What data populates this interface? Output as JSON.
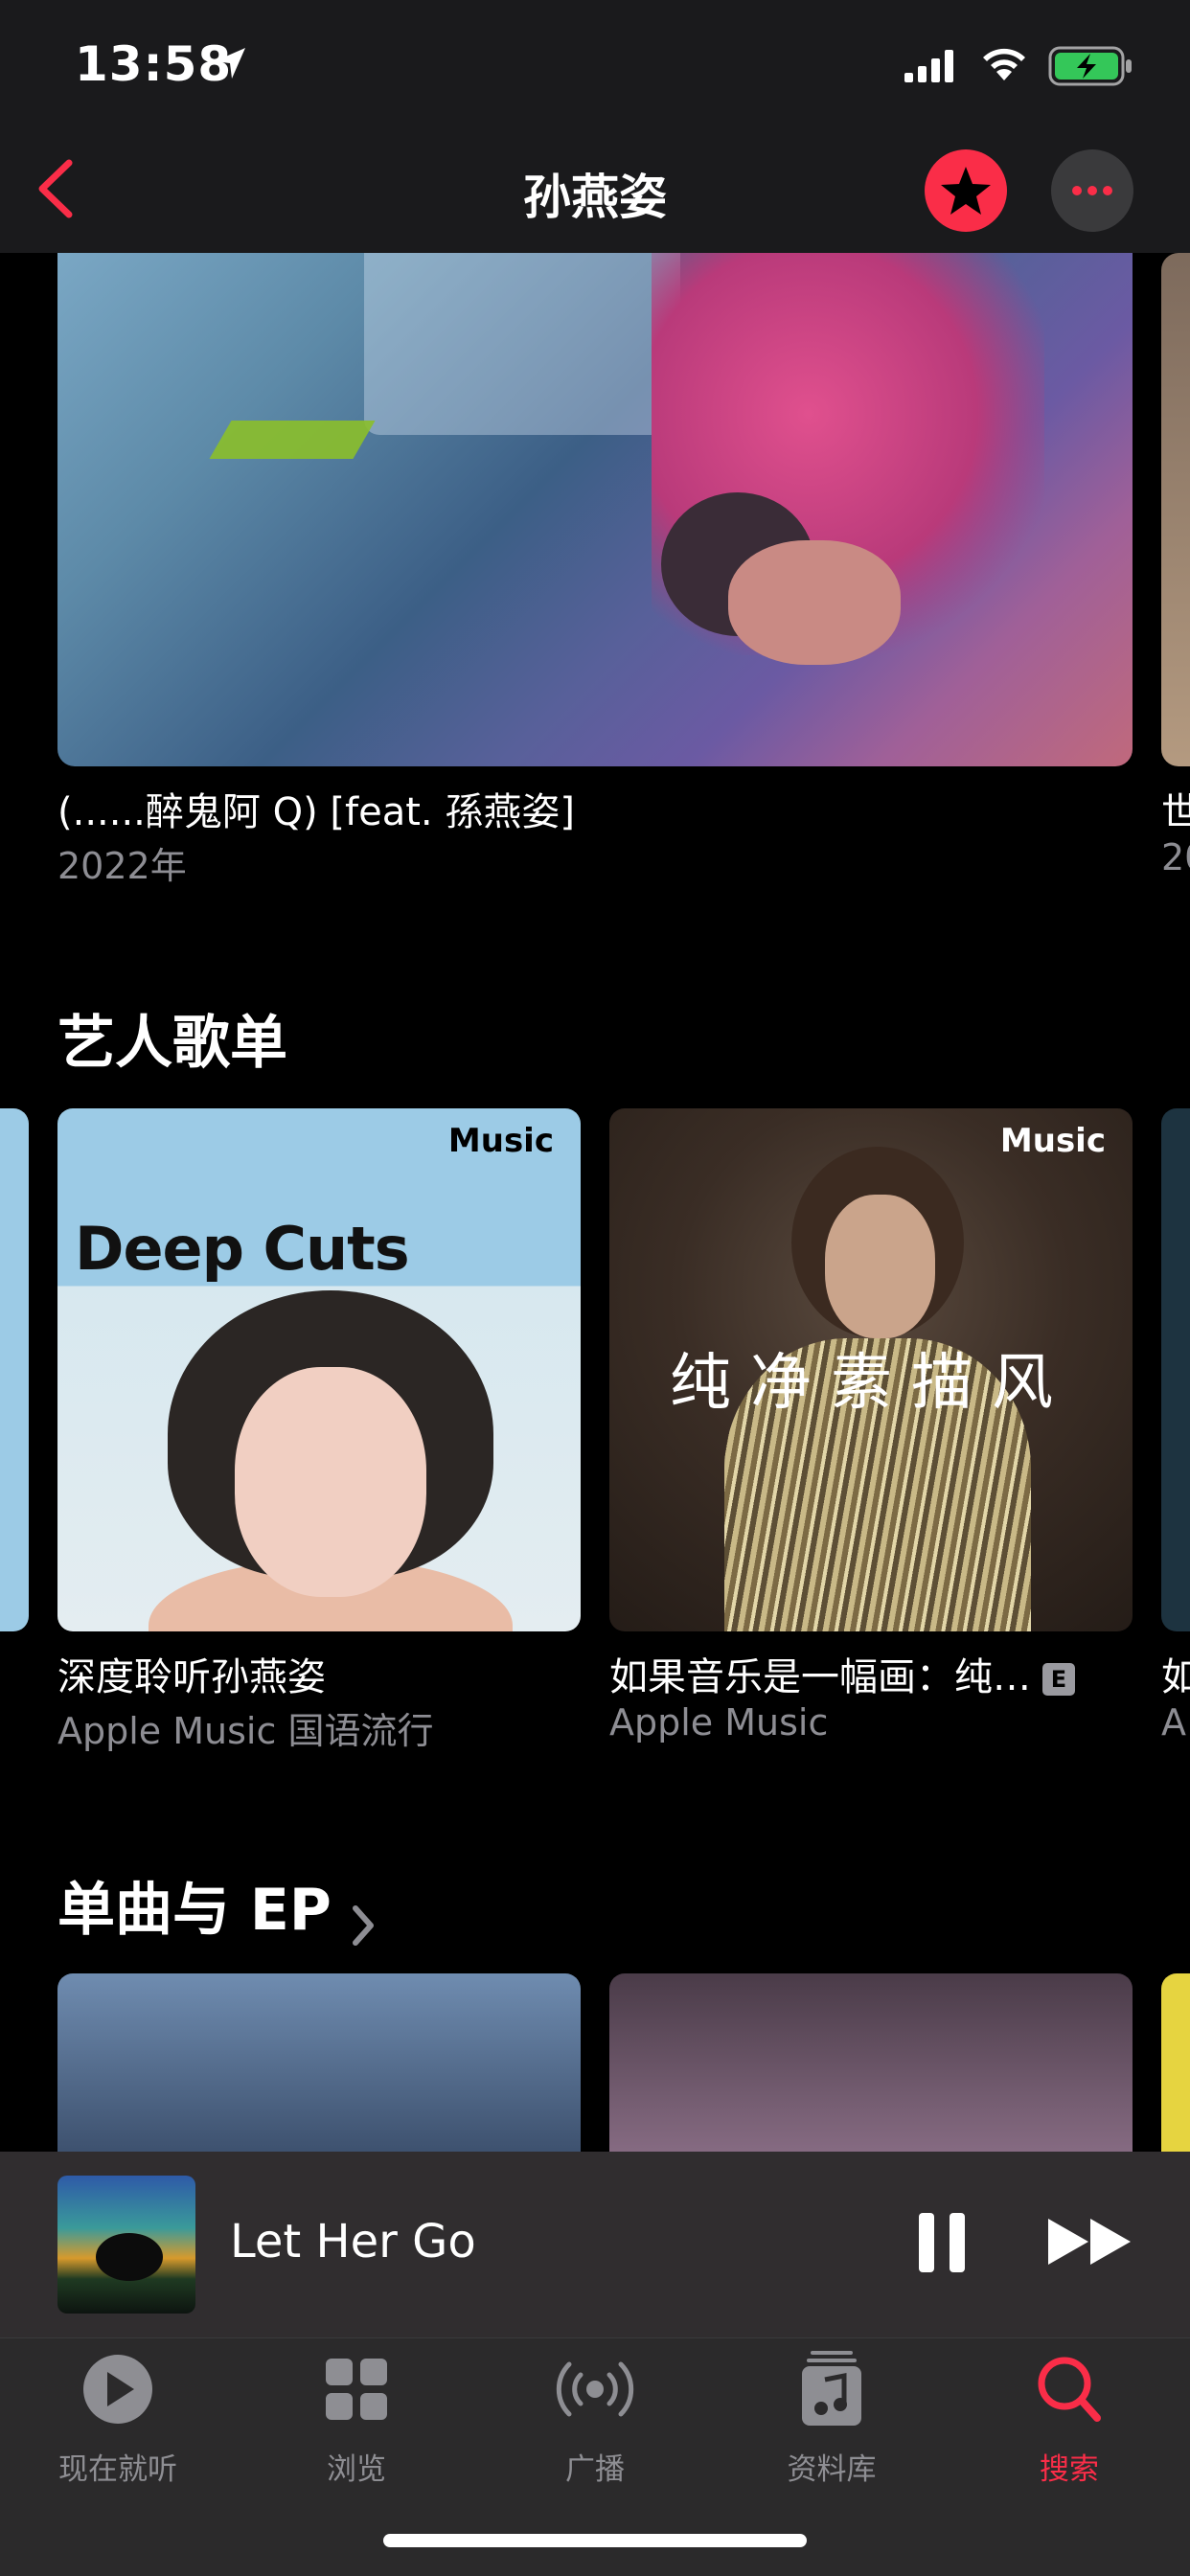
{
  "status_bar": {
    "time": "13:58"
  },
  "nav": {
    "title": "孙燕姿"
  },
  "album_section": {
    "album_title": "(......醉鬼阿 Q) [feat. 孫燕姿]",
    "album_year": "2022年",
    "peek_title": "世",
    "peek_year": "20"
  },
  "playlists_section": {
    "title": "艺人歌单",
    "items": [
      {
        "badge": "Music",
        "cover_text": "Deep Cuts",
        "title": "深度聆听孙燕姿",
        "subtitle": "Apple Music 国语流行"
      },
      {
        "badge": "Music",
        "cover_text": "纯净素描风",
        "title": "如果音乐是一幅画：纯…",
        "explicit": "E",
        "subtitle": "Apple Music"
      }
    ],
    "peek_title": "如",
    "peek_subtitle": "A"
  },
  "singles_section": {
    "title": "单曲与 EP"
  },
  "mini_player": {
    "title": "Let Her Go"
  },
  "tabbar": {
    "tabs": [
      {
        "label": "现在就听",
        "icon": "play-circle-icon"
      },
      {
        "label": "浏览",
        "icon": "grid-icon"
      },
      {
        "label": "广播",
        "icon": "radio-icon"
      },
      {
        "label": "资料库",
        "icon": "library-icon"
      },
      {
        "label": "搜索",
        "icon": "search-icon"
      }
    ],
    "active_index": 4
  },
  "colors": {
    "accent": "#fa2d48",
    "background": "#000000",
    "secondary_text": "#8d8d93"
  }
}
